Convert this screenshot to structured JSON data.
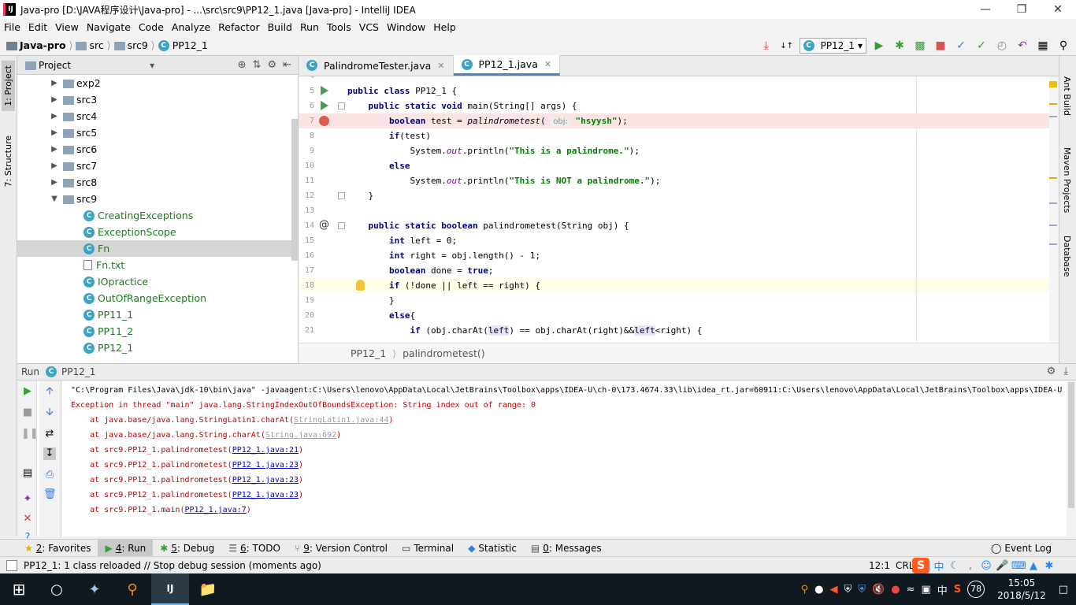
{
  "window": {
    "title": "Java-pro [D:\\JAVA程序设计\\Java-pro] - ...\\src\\src9\\PP12_1.java [Java-pro] - IntelliJ IDEA",
    "app_icon": "IJ"
  },
  "menu": [
    "File",
    "Edit",
    "View",
    "Navigate",
    "Code",
    "Analyze",
    "Refactor",
    "Build",
    "Run",
    "Tools",
    "VCS",
    "Window",
    "Help"
  ],
  "breadcrumb": [
    "Java-pro",
    "src",
    "src9",
    "PP12_1"
  ],
  "run_config": "PP12_1",
  "left_strip": {
    "project": "1: Project",
    "structure": "7: Structure"
  },
  "right_strip": {
    "ant": "Ant Build",
    "maven": "Maven Projects",
    "database": "Database"
  },
  "project_panel": {
    "title": "Project",
    "tree": [
      {
        "label": "exp2",
        "kind": "folder",
        "arrow": "▶"
      },
      {
        "label": "src3",
        "kind": "folder",
        "arrow": "▶"
      },
      {
        "label": "src4",
        "kind": "folder",
        "arrow": "▶"
      },
      {
        "label": "src5",
        "kind": "folder",
        "arrow": "▶"
      },
      {
        "label": "src6",
        "kind": "folder",
        "arrow": "▶"
      },
      {
        "label": "src7",
        "kind": "folder",
        "arrow": "▶"
      },
      {
        "label": "src8",
        "kind": "folder",
        "arrow": "▶"
      },
      {
        "label": "src9",
        "kind": "folder",
        "arrow": "▼"
      },
      {
        "label": "CreatingExceptions",
        "kind": "class"
      },
      {
        "label": "ExceptionScope",
        "kind": "class"
      },
      {
        "label": "Fn",
        "kind": "class",
        "selected": true
      },
      {
        "label": "Fn.txt",
        "kind": "file"
      },
      {
        "label": "IOpractice",
        "kind": "class"
      },
      {
        "label": "OutOfRangeException",
        "kind": "class"
      },
      {
        "label": "PP11_1",
        "kind": "class"
      },
      {
        "label": "PP11_2",
        "kind": "class"
      },
      {
        "label": "PP12_1",
        "kind": "class"
      }
    ]
  },
  "editor": {
    "tabs": [
      {
        "label": "PalindromeTester.java",
        "active": false
      },
      {
        "label": "PP12_1.java",
        "active": true
      }
    ],
    "breadcrumb": [
      "PP12_1",
      "palindrometest()"
    ],
    "lines": [
      {
        "n": "4",
        "text": ""
      },
      {
        "n": "5",
        "text": "public class PP12_1 {"
      },
      {
        "n": "6",
        "text": "    public static void main(String[] args) {"
      },
      {
        "n": "7",
        "text": "        boolean test = palindrometest( obj: \"hsyysh\");"
      },
      {
        "n": "8",
        "text": "        if(test)"
      },
      {
        "n": "9",
        "text": "            System.out.println(\"This is a palindrome.\");"
      },
      {
        "n": "10",
        "text": "        else"
      },
      {
        "n": "11",
        "text": "            System.out.println(\"This is NOT a palindrome.\");"
      },
      {
        "n": "12",
        "text": "    }"
      },
      {
        "n": "13",
        "text": ""
      },
      {
        "n": "14",
        "text": "    public static boolean palindrometest(String obj) {"
      },
      {
        "n": "15",
        "text": "        int left = 0;"
      },
      {
        "n": "16",
        "text": "        int right = obj.length() - 1;"
      },
      {
        "n": "17",
        "text": "        boolean done = true;"
      },
      {
        "n": "18",
        "text": "        if (!done || left == right) {"
      },
      {
        "n": "19",
        "text": "        }"
      },
      {
        "n": "20",
        "text": "        else{"
      },
      {
        "n": "21",
        "text": "            if (obj.charAt(left) == obj.charAt(right)&&left<right) {"
      }
    ]
  },
  "run_panel": {
    "title": "Run",
    "config": "PP12_1",
    "console": [
      "\"C:\\Program Files\\Java\\jdk-10\\bin\\java\" -javaagent:C:\\Users\\lenovo\\AppData\\Local\\JetBrains\\Toolbox\\apps\\IDEA-U\\ch-0\\173.4674.33\\lib\\idea_rt.jar=60911:C:\\Users\\lenovo\\AppData\\Local\\JetBrains\\Toolbox\\apps\\IDEA-U",
      "Exception in thread \"main\" java.lang.StringIndexOutOfBoundsException: String index out of range: 0",
      {
        "prefix": "    at java.base/java.lang.StringLatin1.charAt(",
        "link": "StringLatin1.java:44",
        "suffix": ")"
      },
      {
        "prefix": "    at java.base/java.lang.String.charAt(",
        "link": "String.java:692",
        "suffix": ")"
      },
      {
        "prefix": "    at src9.PP12_1.palindrometest(",
        "link": "PP12_1.java:21",
        "suffix": ")"
      },
      {
        "prefix": "    at src9.PP12_1.palindrometest(",
        "link": "PP12_1.java:23",
        "suffix": ")"
      },
      {
        "prefix": "    at src9.PP12_1.palindrometest(",
        "link": "PP12_1.java:23",
        "suffix": ")"
      },
      {
        "prefix": "    at src9.PP12_1.palindrometest(",
        "link": "PP12_1.java:23",
        "suffix": ")"
      },
      {
        "prefix": "    at src9.PP12_1.main(",
        "link": "PP12_1.java:7",
        "suffix": ")"
      }
    ]
  },
  "bottom_tabs": [
    {
      "num": "2",
      "label": ": Favorites",
      "icon": "★"
    },
    {
      "num": "4",
      "label": ": Run",
      "icon": "▶",
      "active": true
    },
    {
      "num": "5",
      "label": ": Debug",
      "icon": "✱"
    },
    {
      "num": "6",
      "label": ": TODO",
      "icon": "☰"
    },
    {
      "num": "9",
      "label": ": Version Control",
      "icon": "⑂"
    },
    {
      "num": "",
      "label": "Terminal",
      "icon": "▭"
    },
    {
      "num": "",
      "label": "Statistic",
      "icon": "◆"
    },
    {
      "num": "0",
      "label": ": Messages",
      "icon": "▤"
    }
  ],
  "event_log": "Event Log",
  "status": {
    "message": "PP12_1: 1 class reloaded // Stop debug session (moments ago)",
    "position": "12:1",
    "line_sep": "CRLF"
  },
  "taskbar": {
    "time": "15:05",
    "date": "2018/5/12",
    "badge": "78",
    "ime": "中",
    "ime_logo": "S"
  },
  "colors": {
    "keyword": "#000080",
    "string": "#008000",
    "error": "#c00000",
    "link": "#0000cc",
    "breakpoint": "#e0584f",
    "run": "#499c54"
  }
}
